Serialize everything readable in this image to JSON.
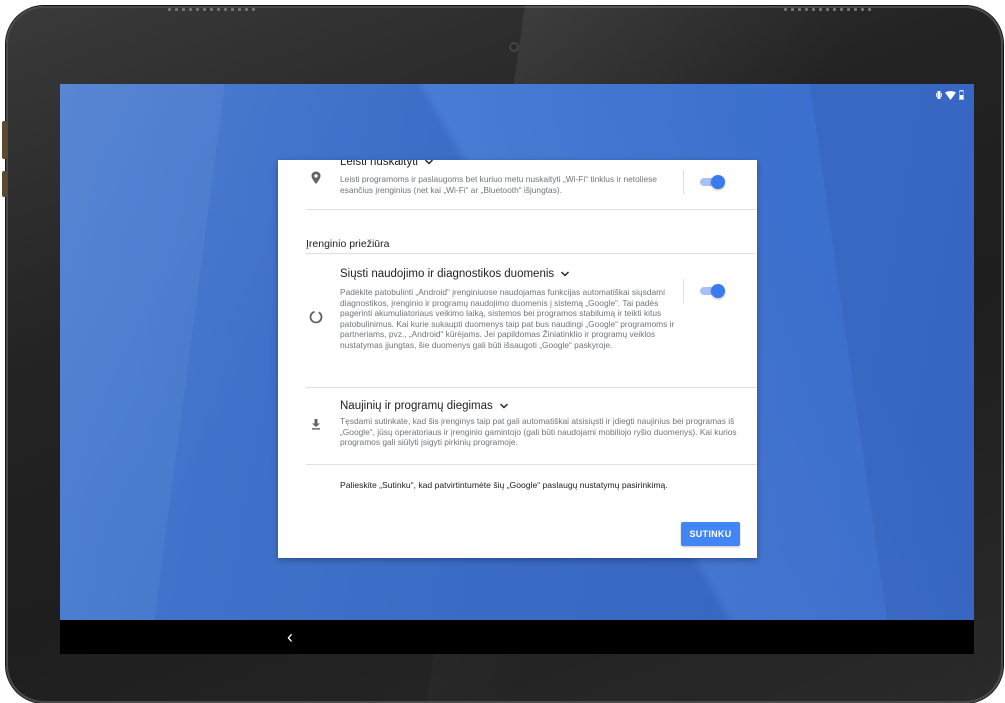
{
  "status_bar": {
    "icons": [
      "vibrate-icon",
      "wifi-icon",
      "battery-icon"
    ]
  },
  "card": {
    "scan_item": {
      "title": "Leisti nuskaityti",
      "description": "Leisti programoms ir paslaugoms bet kuriuo metu nuskaityti „Wi-Fi“ tinklus ir netoliese esančius įrenginius (net kai „Wi-Fi“ ar „Bluetooth“ išjungtas).",
      "icon": "location-pin-icon",
      "toggle_on": true
    },
    "section_header": "Įrenginio priežiūra",
    "diagnostics_item": {
      "title": "Siųsti naudojimo ir diagnostikos duomenis",
      "description": "Padėkite patobulinti „Android“ įrenginiuose naudojamas funkcijas automatiškai siųsdami diagnostikos, įrenginio ir programų naudojimo duomenis į sistemą „Google“. Tai padės pagerinti akumuliatoriaus veikimo laiką, sistemos bei programos stabilumą ir teikti kitus patobulinimus. Kai kurie sukaupti duomenys taip pat bus naudingi „Google“ programoms ir partneriams, pvz., „Android“ kūrėjams. Jei papildomas Žiniatinklio ir programų veiklos nustatymas įjungtas, šie duomenys gali būti išsaugoti „Google“ paskyroje.",
      "icon": "progress-circle-icon",
      "toggle_on": true
    },
    "updates_item": {
      "title": "Naujinių ir programų diegimas",
      "description": "Tęsdami sutinkate, kad šis įrenginys taip pat gali automatiškai atsisiųsti ir įdiegti naujinius bei programas iš „Google“, jūsų operatoriaus ir įrenginio gamintojo (gali būti naudojami mobiliojo ryšio duomenys). Kai kurios programos gali siūlyti įsigyti pirkinių programoje.",
      "icon": "download-icon"
    },
    "footer_text": "Palieskite „Sutinku“, kad patvirtintumėte šių „Google“ paslaugų nustatymų pasirinkimą.",
    "agree_button": "SUTINKU"
  },
  "nav": {
    "back_icon": "back-chevron-icon",
    "back_glyph": "‹"
  },
  "colors": {
    "accent": "#4285f4",
    "toggle_thumb": "#3a79ee",
    "toggle_track": "#a6c1f5",
    "wallpaper": "#4179d6"
  }
}
